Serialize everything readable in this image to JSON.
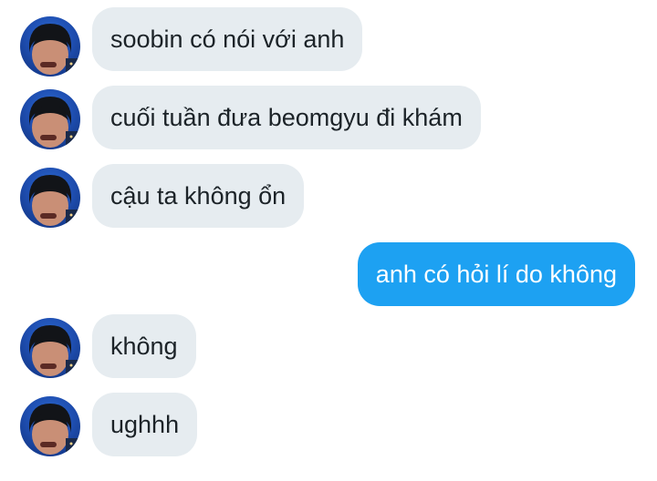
{
  "conversation": {
    "messages": [
      {
        "text": "soobin có nói với anh",
        "direction": "incoming"
      },
      {
        "text": "cuối tuần đưa beomgyu đi khám",
        "direction": "incoming"
      },
      {
        "text": "cậu ta không ổn",
        "direction": "incoming"
      },
      {
        "text": "anh có hỏi lí do không",
        "direction": "outgoing"
      },
      {
        "text": "không",
        "direction": "incoming"
      },
      {
        "text": "ughhh",
        "direction": "incoming"
      }
    ]
  },
  "colors": {
    "incoming_bubble": "#e6ecf0",
    "outgoing_bubble": "#1da1f2",
    "incoming_text": "#1c2328",
    "outgoing_text": "#ffffff"
  }
}
